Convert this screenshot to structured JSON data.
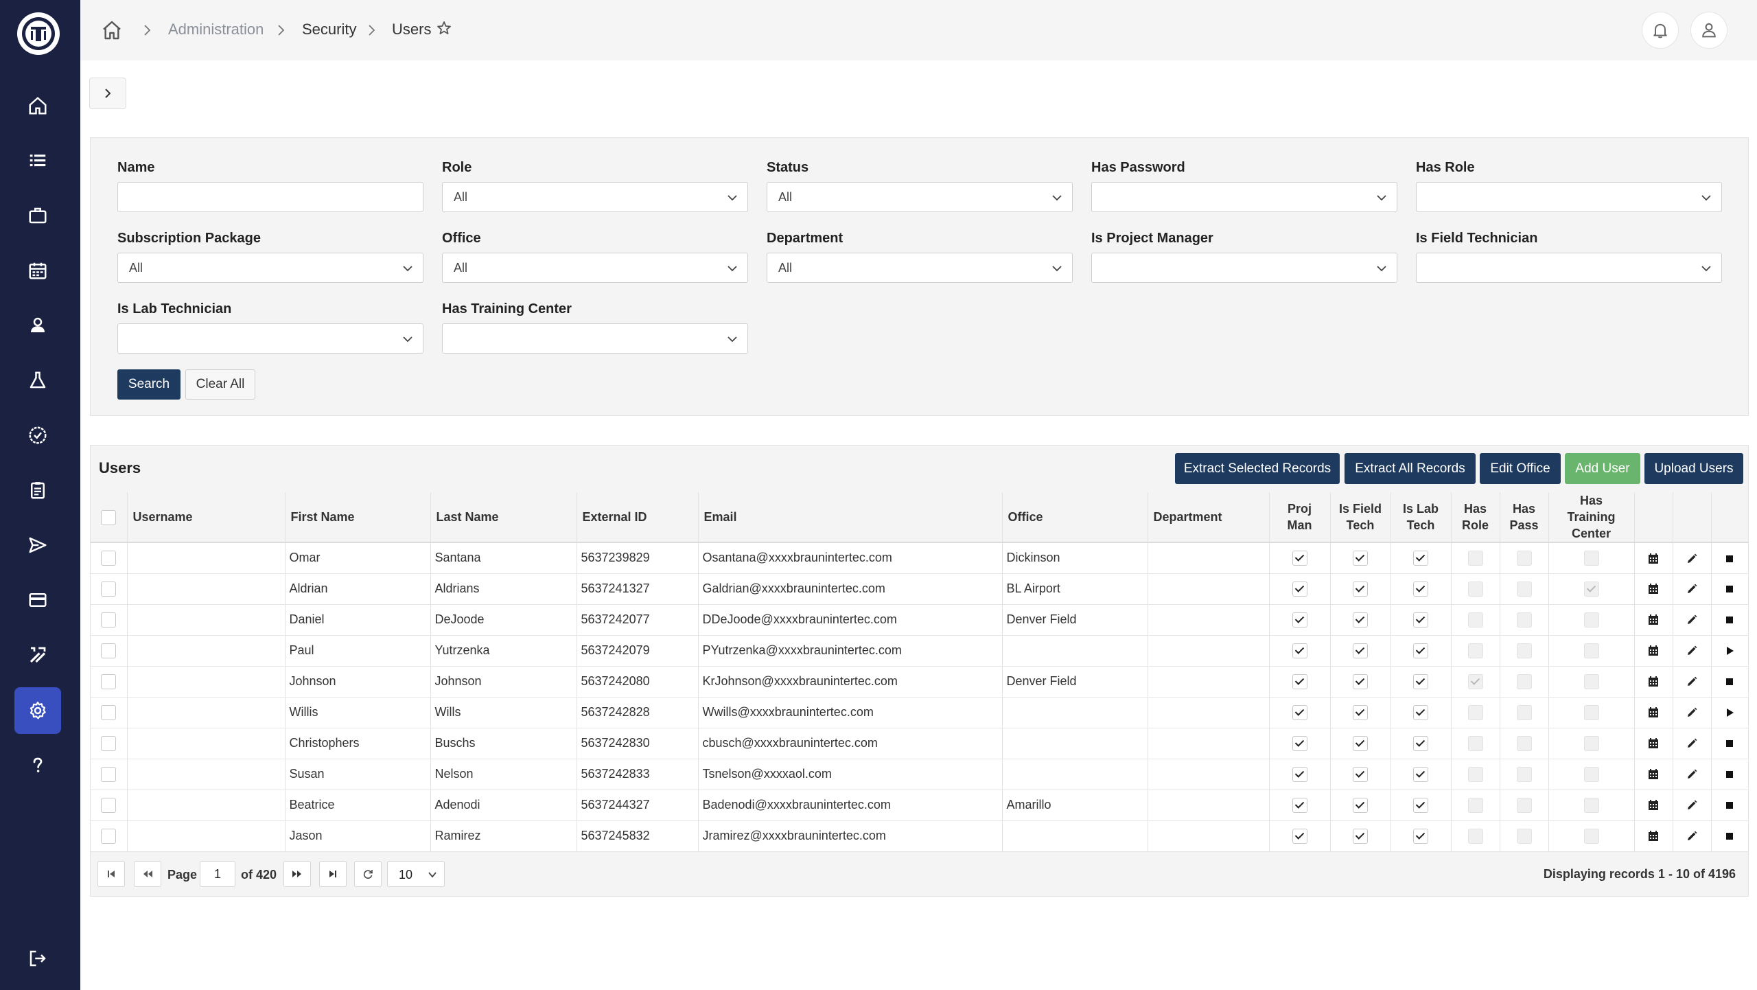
{
  "breadcrumb": {
    "items": [
      "Administration",
      "Security",
      "Users"
    ]
  },
  "filters": {
    "name": {
      "label": "Name",
      "value": ""
    },
    "role": {
      "label": "Role",
      "value": "All"
    },
    "status": {
      "label": "Status",
      "value": "All"
    },
    "has_password": {
      "label": "Has Password",
      "value": ""
    },
    "has_role": {
      "label": "Has Role",
      "value": ""
    },
    "subscription_package": {
      "label": "Subscription Package",
      "value": "All"
    },
    "office": {
      "label": "Office",
      "value": "All"
    },
    "department": {
      "label": "Department",
      "value": "All"
    },
    "is_project_manager": {
      "label": "Is Project Manager",
      "value": ""
    },
    "is_field_technician": {
      "label": "Is Field Technician",
      "value": ""
    },
    "is_lab_technician": {
      "label": "Is Lab Technician",
      "value": ""
    },
    "has_training_center": {
      "label": "Has Training Center",
      "value": ""
    },
    "search_label": "Search",
    "clear_label": "Clear All"
  },
  "users": {
    "title": "Users",
    "actions": {
      "extract_selected": "Extract Selected Records",
      "extract_all": "Extract All Records",
      "edit_office": "Edit Office",
      "add_user": "Add User",
      "upload_users": "Upload Users"
    },
    "columns": {
      "username": "Username",
      "first_name": "First Name",
      "last_name": "Last Name",
      "external_id": "External ID",
      "email": "Email",
      "office": "Office",
      "department": "Department",
      "proj_man": "Proj Man",
      "is_field_tech": "Is Field Tech",
      "is_lab_tech": "Is Lab Tech",
      "has_role": "Has Role",
      "has_pass": "Has Pass",
      "has_training_center": "Has Training Center"
    },
    "rows": [
      {
        "username": "",
        "first": "Omar",
        "last": "Santana",
        "ext": "5637239829",
        "email": "Osantana@xxxxbraunintertec.com",
        "office": "Dickinson",
        "dept": "",
        "pm": true,
        "ft": true,
        "lt": true,
        "role": false,
        "pass": false,
        "tc": false,
        "state": "stop"
      },
      {
        "username": "",
        "first": "Aldrian",
        "last": "Aldrians",
        "ext": "5637241327",
        "email": "Galdrian@xxxxbraunintertec.com",
        "office": "BL Airport",
        "dept": "",
        "pm": true,
        "ft": true,
        "lt": true,
        "role": false,
        "pass": false,
        "tc": true,
        "state": "stop"
      },
      {
        "username": "",
        "first": "Daniel",
        "last": "DeJoode",
        "ext": "5637242077",
        "email": "DDeJoode@xxxxbraunintertec.com",
        "office": "Denver Field",
        "dept": "",
        "pm": true,
        "ft": true,
        "lt": true,
        "role": false,
        "pass": false,
        "tc": false,
        "state": "stop"
      },
      {
        "username": "",
        "first": "Paul",
        "last": "Yutrzenka",
        "ext": "5637242079",
        "email": "PYutrzenka@xxxxbraunintertec.com",
        "office": "",
        "dept": "",
        "pm": true,
        "ft": true,
        "lt": true,
        "role": false,
        "pass": false,
        "tc": false,
        "state": "play"
      },
      {
        "username": "",
        "first": "Johnson",
        "last": "Johnson",
        "ext": "5637242080",
        "email": "KrJohnson@xxxxbraunintertec.com",
        "office": "Denver Field",
        "dept": "",
        "pm": true,
        "ft": true,
        "lt": true,
        "role": true,
        "pass": false,
        "tc": false,
        "state": "stop"
      },
      {
        "username": "",
        "first": "Willis",
        "last": "Wills",
        "ext": "5637242828",
        "email": "Wwills@xxxxbraunintertec.com",
        "office": "",
        "dept": "",
        "pm": true,
        "ft": true,
        "lt": true,
        "role": false,
        "pass": false,
        "tc": false,
        "state": "play"
      },
      {
        "username": "",
        "first": "Christophers",
        "last": "Buschs",
        "ext": "5637242830",
        "email": "cbusch@xxxxbraunintertec.com",
        "office": "",
        "dept": "",
        "pm": true,
        "ft": true,
        "lt": true,
        "role": false,
        "pass": false,
        "tc": false,
        "state": "stop"
      },
      {
        "username": "",
        "first": "Susan",
        "last": "Nelson",
        "ext": "5637242833",
        "email": "Tsnelson@xxxxaol.com",
        "office": "",
        "dept": "",
        "pm": true,
        "ft": true,
        "lt": true,
        "role": false,
        "pass": false,
        "tc": false,
        "state": "stop"
      },
      {
        "username": "",
        "first": "Beatrice",
        "last": "Adenodi",
        "ext": "5637244327",
        "email": "Badenodi@xxxxbraunintertec.com",
        "office": "Amarillo",
        "dept": "",
        "pm": true,
        "ft": true,
        "lt": true,
        "role": false,
        "pass": false,
        "tc": false,
        "state": "stop"
      },
      {
        "username": "",
        "first": "Jason",
        "last": "Ramirez",
        "ext": "5637245832",
        "email": "Jramirez@xxxxbraunintertec.com",
        "office": "",
        "dept": "",
        "pm": true,
        "ft": true,
        "lt": true,
        "role": false,
        "pass": false,
        "tc": false,
        "state": "stop"
      }
    ]
  },
  "pager": {
    "page_label": "Page",
    "page": "1",
    "of_label": "of 420",
    "page_size": "10",
    "display_text": "Displaying records 1 - 10 of 4196"
  },
  "icons": {
    "sidebar": [
      "home-icon",
      "list-icon",
      "briefcase-icon",
      "calendar-icon",
      "user-icon",
      "flask-icon",
      "check-badge-icon",
      "clipboard-icon",
      "send-icon",
      "card-icon",
      "tools-icon",
      "gear-icon",
      "help-icon",
      "logout-icon"
    ]
  },
  "colors": {
    "sidebar": "#1b2140",
    "active": "#3a4fbf",
    "primary": "#1e3a5f",
    "success": "#6ab56d"
  }
}
